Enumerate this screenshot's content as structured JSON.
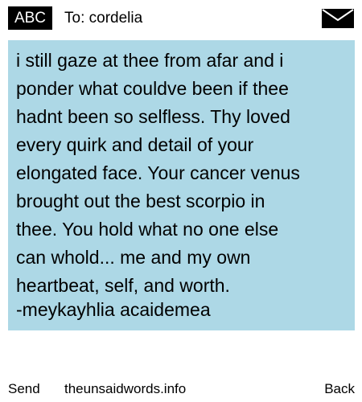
{
  "header": {
    "input_mode": "ABC",
    "to_label": "To: cordelia",
    "envelope_icon": "envelope-icon"
  },
  "message": {
    "body": "i still gaze at thee from afar and i\nponder what couldve been if thee\nhadnt been so selfless. Thy loved\nevery quirk and detail of your\nelongated face. Your cancer venus\nbrought out the best scorpio in\nthee. You hold what no one else\ncan whold... me and my own\nheartbeat, self, and worth.",
    "signature": "-meykayhlia acaidemea",
    "background_color": "#add8e6"
  },
  "footer": {
    "send_label": "Send",
    "site_label": "theunsaidwords.info",
    "back_label": "Back"
  }
}
